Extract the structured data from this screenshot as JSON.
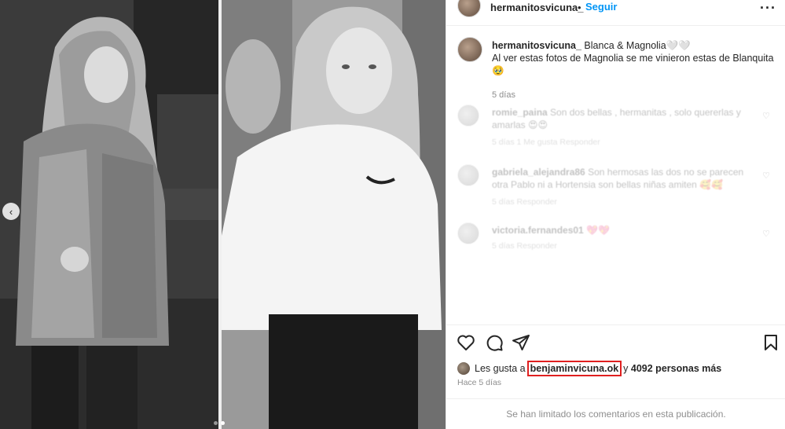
{
  "post": {
    "author": "hermanitosvicuna_",
    "separator": "•",
    "follow_label": "Seguir",
    "more_icon": "more-horizontal-icon"
  },
  "caption": {
    "user": "hermanitosvicuna_",
    "line1": "Blanca & Magnolia🤍🤍",
    "line2": "Al ver estas fotos de Magnolia se me vinieron estas de Blanquita 🥹",
    "time": "5 días"
  },
  "comments": [
    {
      "user": "romie_paina",
      "text": "Son dos bellas , hermanitas , solo quererlas y amarlas 😍😍",
      "meta": "5 días   1 Me gusta   Responder"
    },
    {
      "user": "gabriela_alejandra86",
      "text": "Son hermosas las dos no se parecen otra Pablo ni a Hortensia son bellas niñas amiten 🥰🥰",
      "meta": "5 días   Responder"
    },
    {
      "user": "victoria.fernandes01",
      "text": "💖💖",
      "meta": "5 días   Responder"
    }
  ],
  "actions": {
    "like_icon": "heart-icon",
    "comment_icon": "comment-icon",
    "share_icon": "share-icon",
    "save_icon": "bookmark-icon"
  },
  "likes": {
    "prefix": "Les gusta a",
    "liker": "benjaminvicuna.ok",
    "mid": "y",
    "count": "4092 personas más"
  },
  "timestamp": "Hace 5 días",
  "comments_limited": "Se han limitado los comentarios en esta publicación.",
  "colors": {
    "follow": "#0095f6",
    "highlight_border": "#e02020",
    "muted": "#8e8e8e"
  }
}
